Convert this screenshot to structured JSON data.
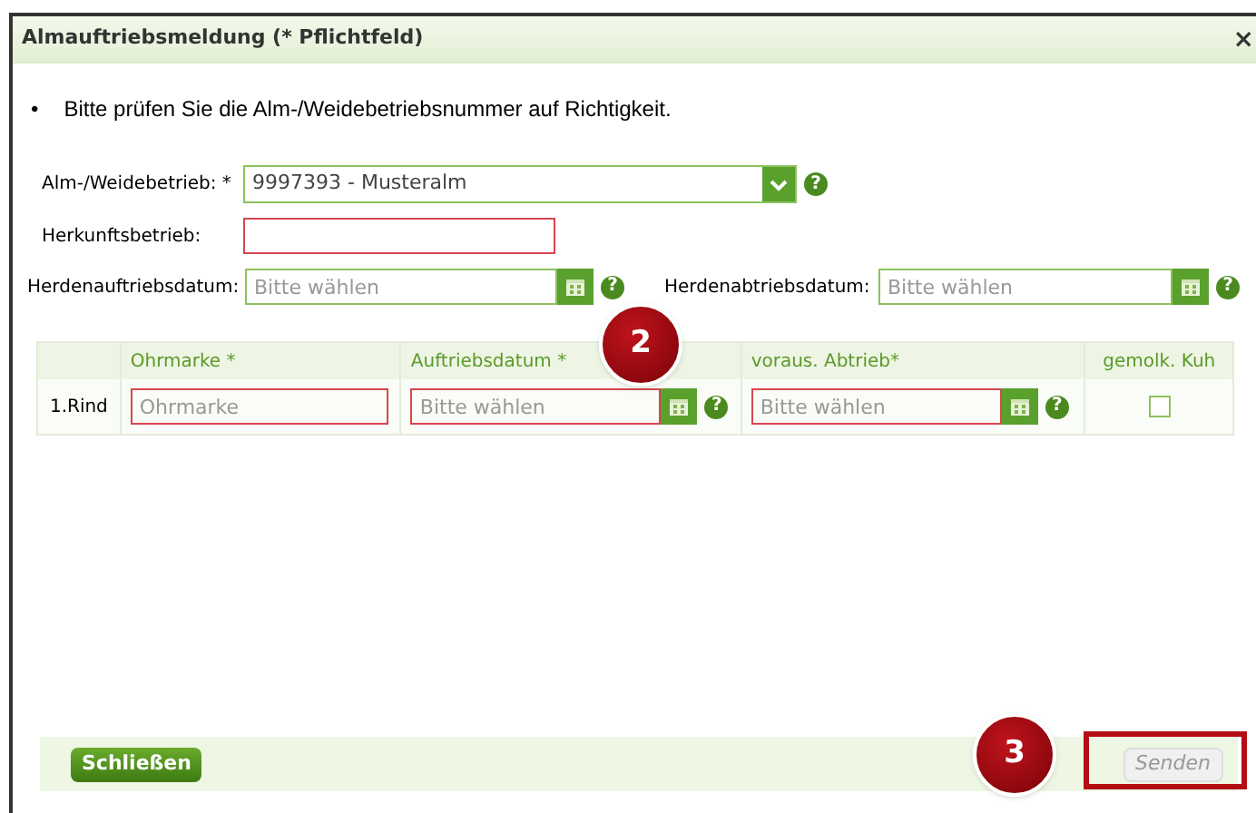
{
  "dialog": {
    "title": "Almauftriebsmeldung (* Pflichtfeld)",
    "close": "×"
  },
  "notice": {
    "bullet": "•",
    "text": "Bitte prüfen Sie die Alm-/Weidebetriebsnummer auf Richtigkeit."
  },
  "alm_field": {
    "label": "Alm-/Weidebetrieb: *",
    "value": "9997393 - Musteralm",
    "help": "?"
  },
  "herkunft_field": {
    "label": "Herkunftsbetrieb:",
    "invalid": true
  },
  "date_fields": [
    {
      "label": "Herdenauftriebsdatum:",
      "placeholder": "Bitte wählen",
      "help": "?"
    },
    {
      "label": "Herdenabtriebsdatum:",
      "placeholder": "Bitte wählen",
      "help": "?"
    }
  ],
  "table": {
    "columns": [
      "Ohrmarke *",
      "Auftriebsdatum *",
      "voraus. Abtrieb*",
      "gemolk. Kuh"
    ],
    "rows": [
      {
        "label": "1.Rind",
        "ohrmarke": {
          "placeholder": "Ohrmarke",
          "invalid": true
        },
        "auftrieb": {
          "placeholder": "Bitte wählen",
          "invalid": true,
          "help": "?"
        },
        "abtrieb": {
          "placeholder": "Bitte wählen",
          "invalid": true,
          "help": "?"
        },
        "gemolken": {
          "checked": false
        }
      }
    ]
  },
  "buttons": [
    {
      "label": "Schließen",
      "disabled": false
    },
    {
      "label": "Senden",
      "disabled": true
    }
  ],
  "annotations": [
    {
      "number": "2",
      "kind": "badge"
    },
    {
      "number": "3",
      "kind": "framed"
    }
  ]
}
